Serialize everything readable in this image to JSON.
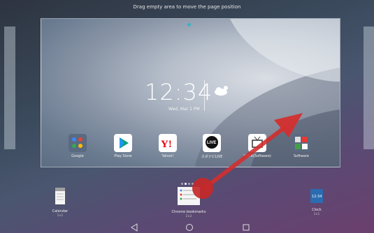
{
  "hint_text": "Drag empty area to move the page position",
  "clock": {
    "time": "12:34",
    "date": "Wed, Mar 1 PM"
  },
  "apps": [
    {
      "label": "Google",
      "icon": "google-folder-icon"
    },
    {
      "label": "Play Store",
      "icon": "play-store-icon"
    },
    {
      "label": "Yahoo!",
      "icon": "yahoo-icon"
    },
    {
      "label": "スポナビLIVE",
      "icon": "sponavi-live-icon"
    },
    {
      "label": "YOUR(Software)",
      "icon": "dtv-icon"
    },
    {
      "label": "Software",
      "icon": "software-folder-icon"
    }
  ],
  "widgets": [
    {
      "label": "Calendar",
      "sub": "1×1"
    },
    {
      "label": "Chrome bookmarks",
      "sub": "2×2"
    },
    {
      "label": "Clock",
      "sub": "1×1"
    }
  ],
  "nav": {
    "back": "back-icon",
    "home": "home-icon",
    "recents": "recents-icon"
  },
  "colors": {
    "accent": "#d32f2f",
    "teal": "#3bb3c3"
  }
}
